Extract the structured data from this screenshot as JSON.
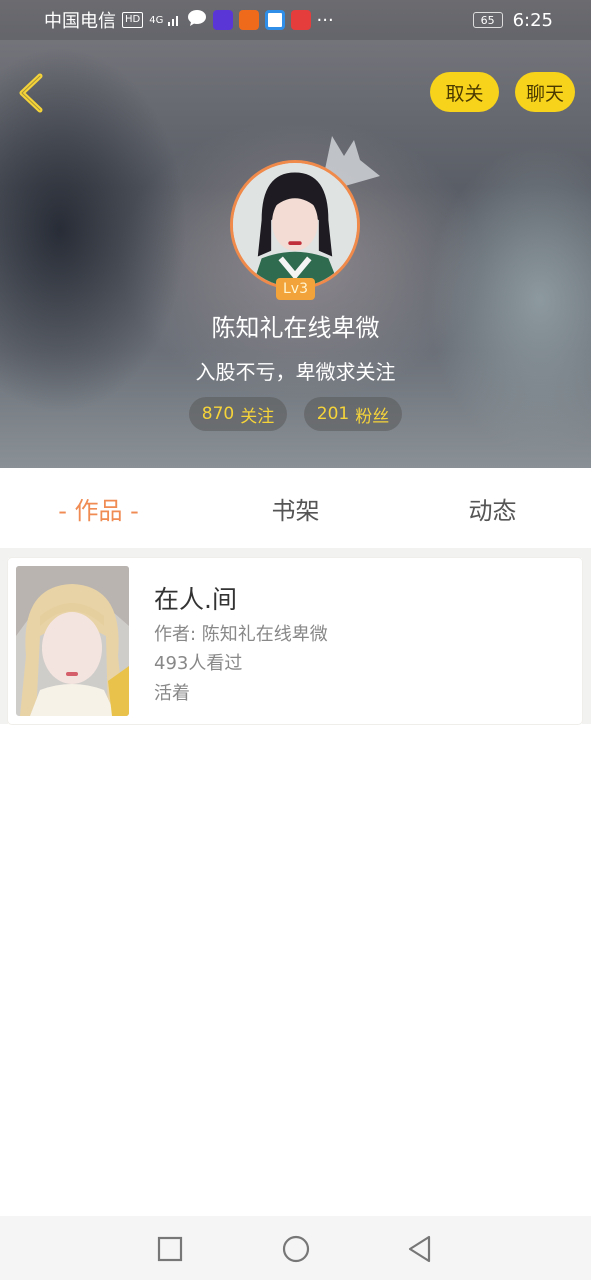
{
  "status_bar": {
    "carrier": "中国电信",
    "hd_badge": "HD",
    "signal": "4G",
    "more": "···",
    "battery": "65",
    "time": "6:25"
  },
  "header": {
    "back_icon": "chevron-left-icon",
    "unfollow_label": "取关",
    "chat_label": "聊天"
  },
  "profile": {
    "level": "Lv3",
    "name": "陈知礼在线卑微",
    "signature": "入股不亏，卑微求关注",
    "following_count": "870",
    "following_label": "关注",
    "fans_count": "201",
    "fans_label": "粉丝"
  },
  "tabs": [
    {
      "label": "- 作品 -",
      "active": true
    },
    {
      "label": "书架",
      "active": false
    },
    {
      "label": "动态",
      "active": false
    }
  ],
  "works": [
    {
      "title": "在人.间",
      "author": "作者: 陈知礼在线卑微",
      "views": "493人看过",
      "tag": "活着"
    }
  ],
  "colors": {
    "accent_orange": "#ef8b53",
    "button_yellow": "#f7d31b",
    "stat_yellow": "#f5d43a",
    "level_badge": "#f2a33a"
  },
  "nav_bar": {
    "recent_icon": "square-icon",
    "home_icon": "circle-icon",
    "back_icon": "triangle-back-icon"
  }
}
